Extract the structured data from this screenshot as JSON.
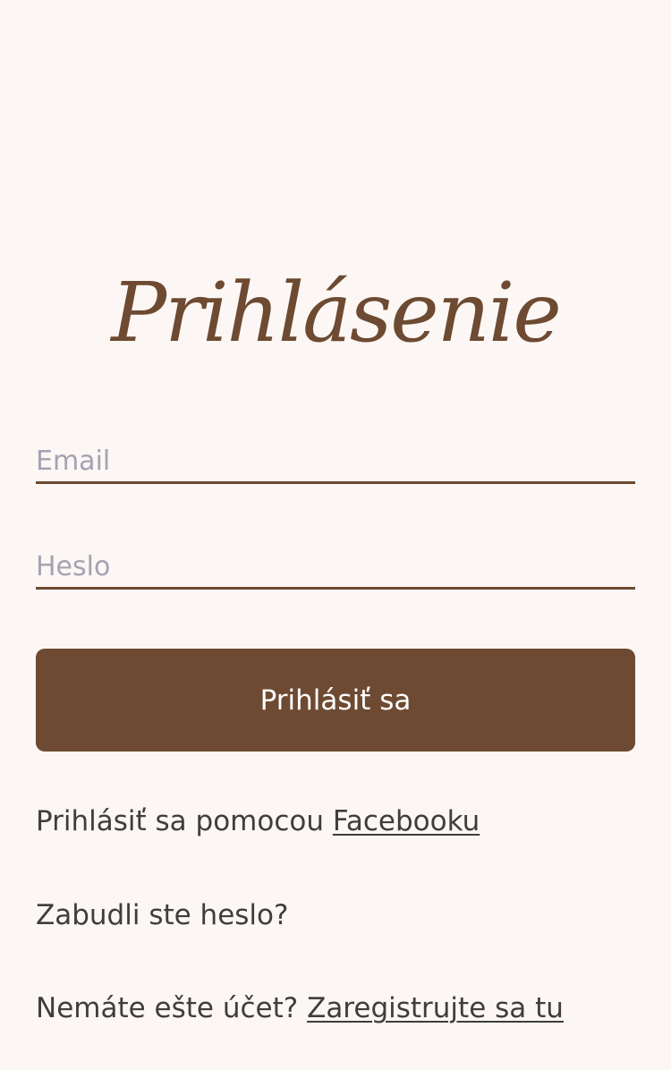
{
  "title": "Prihlásenie",
  "form": {
    "email_placeholder": "Email",
    "password_placeholder": "Heslo",
    "submit_label": "Prihlásiť sa"
  },
  "facebook": {
    "prefix": "Prihlásiť sa pomocou ",
    "link": "Facebooku"
  },
  "forgot_password": "Zabudli ste heslo?",
  "register": {
    "prefix": "Nemáte ešte účet? ",
    "link": "Zaregistrujte sa tu"
  },
  "colors": {
    "background": "#fcf7f4",
    "accent": "#6d4a31",
    "text": "#3e3e3e",
    "placeholder": "#a3a3b2"
  }
}
